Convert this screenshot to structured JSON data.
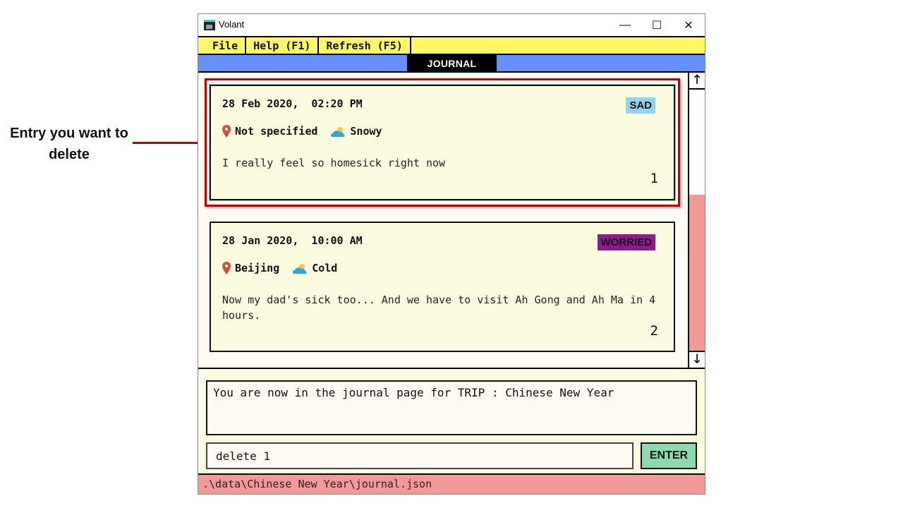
{
  "annotation": {
    "text": "Entry you want to delete",
    "color": "#c00000"
  },
  "window": {
    "title": "Volant",
    "controls": {
      "minimize": "—",
      "maximize": "☐",
      "close": "✕"
    }
  },
  "menu": {
    "items": [
      {
        "label": "File"
      },
      {
        "label": "Help (F1)"
      },
      {
        "label": "Refresh (F5)"
      }
    ]
  },
  "tabs": {
    "active": "JOURNAL"
  },
  "entries": [
    {
      "date": "28 Feb 2020,  02:20 PM",
      "location": "Not specified",
      "weather": "Snowy",
      "text": "I really feel so homesick right now",
      "mood": "SAD",
      "mood_color": "#94d3ef",
      "index": "1"
    },
    {
      "date": "28 Jan 2020,  10:00 AM",
      "location": "Beijing",
      "weather": "Cold",
      "text": "Now my dad's sick too... And we have to visit Ah Gong and Ah Ma in 4 hours.",
      "mood": "WORRIED",
      "mood_color": "#8e1a8e",
      "index": "2"
    }
  ],
  "scrollbar": {
    "up": "🡑",
    "down": "🡓"
  },
  "result": {
    "text": "You are now in the journal page for TRIP : Chinese New Year"
  },
  "command": {
    "value": "delete 1",
    "enter_label": "ENTER"
  },
  "status": {
    "path": ".\\data\\Chinese New Year\\journal.json"
  },
  "colors": {
    "menu_bg": "#fff766",
    "tab_bg": "#6690ff",
    "card_bg": "#fbfbdf",
    "scroll_thumb": "#f39a96",
    "status_bg": "#f39a96",
    "enter_bg": "#8ed9b0"
  }
}
